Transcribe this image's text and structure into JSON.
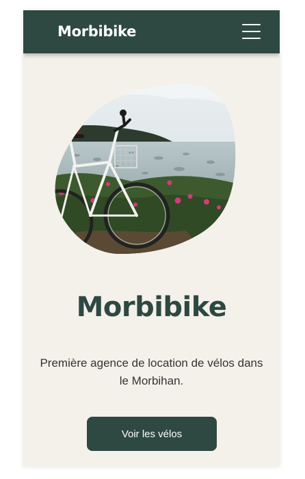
{
  "navbar": {
    "brand": "Morbibike",
    "menu_icon": "hamburger-menu-icon"
  },
  "hero": {
    "image_subject": "bicycle-photo",
    "title": "Morbibike",
    "description": "Première agence de location de vélos dans le Morbihan.",
    "cta_label": "Voir les vélos"
  },
  "colors": {
    "primary": "#2e4842",
    "background": "#f4f1ea",
    "button_text": "#ffffff"
  }
}
